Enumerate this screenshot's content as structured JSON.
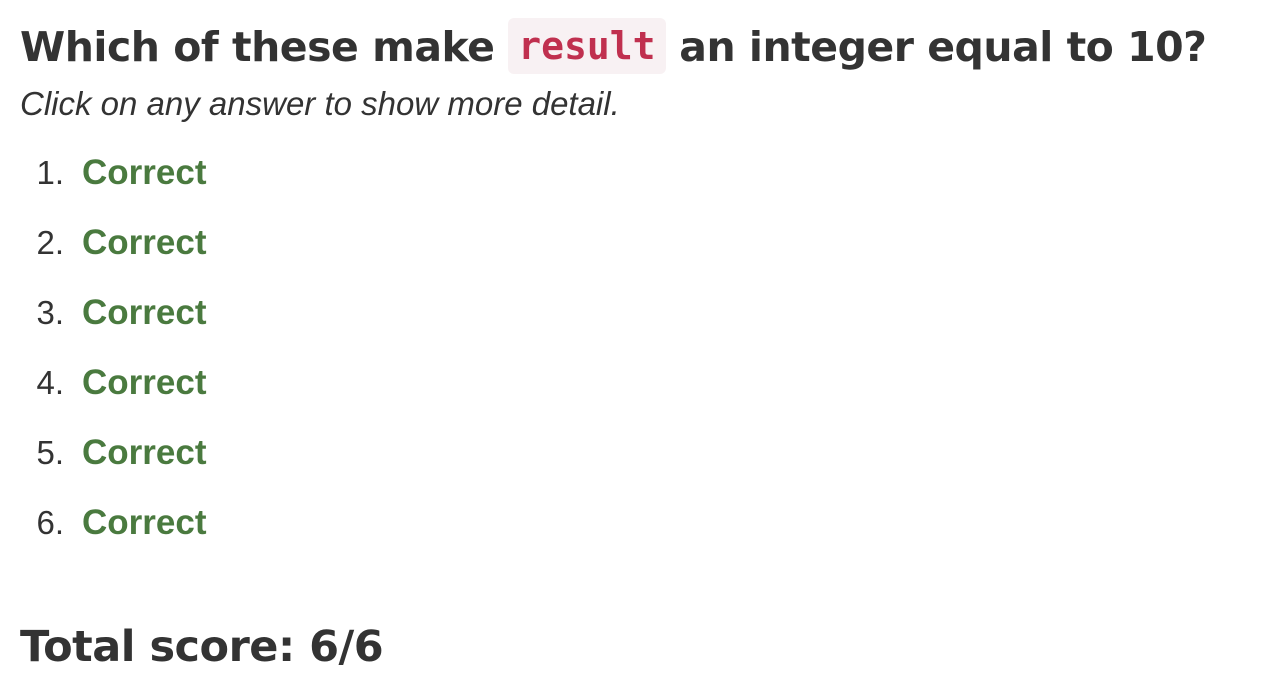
{
  "question": {
    "prefix": "Which of these make",
    "code": "result",
    "suffix": "an integer equal to 10?",
    "instructions": "Click on any answer to show more detail."
  },
  "answers": [
    {
      "number": "1.",
      "status": "Correct"
    },
    {
      "number": "2.",
      "status": "Correct"
    },
    {
      "number": "3.",
      "status": "Correct"
    },
    {
      "number": "4.",
      "status": "Correct"
    },
    {
      "number": "5.",
      "status": "Correct"
    },
    {
      "number": "6.",
      "status": "Correct"
    }
  ],
  "total": {
    "label": "Total score: 6/6"
  },
  "colors": {
    "correct": "#4a7a3f",
    "code_text": "#c0304f",
    "code_background": "#f8f1f3",
    "text": "#333333"
  }
}
